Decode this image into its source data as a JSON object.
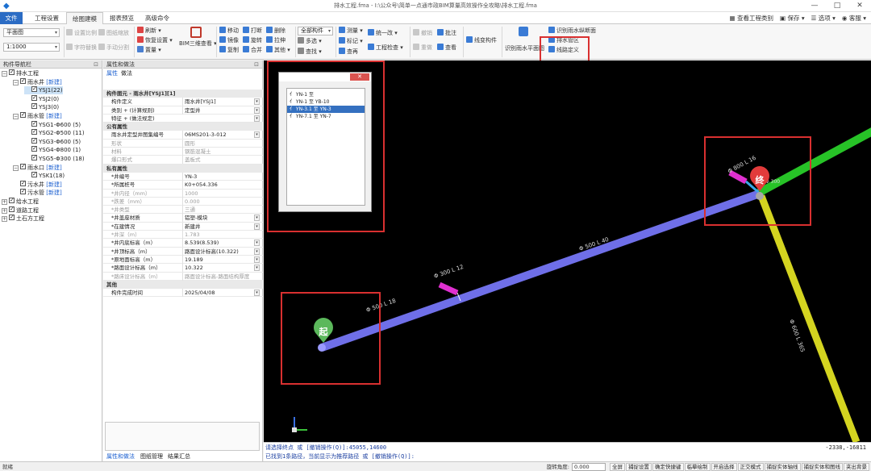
{
  "window": {
    "title": "排水工程.fma - I:\\公众号\\简单一点通市政BIM算量高效操作全攻略\\排水工程.fma",
    "controls": [
      "—",
      "□",
      "✕"
    ]
  },
  "menu": {
    "tabs": [
      "文件",
      "工程设置",
      "绘图建模",
      "报表预览",
      "高级命令"
    ],
    "active_tab": "绘图建模",
    "right": [
      "查看工程类别",
      "保存",
      "选项",
      "客服"
    ]
  },
  "ribbon": {
    "view_combo": "平面图",
    "scale_combo": "1:1000",
    "g1": [
      "设置比例",
      "图纸缩放",
      "字符替换",
      "手动分割"
    ],
    "g2": [
      "刷新",
      "恢复设置",
      "置量"
    ],
    "bim_label": "BIM三维查看",
    "g3": [
      "移动",
      "打断",
      "删除",
      "镜像",
      "旋转",
      "拉伸",
      "复制",
      "合并",
      "其他"
    ],
    "g4": [
      "全部构件",
      "多选",
      "查找"
    ],
    "g5": [
      "测量",
      "标记",
      "查再"
    ],
    "g6": [
      "统一改",
      "工程检查"
    ],
    "g7": [
      "撤销",
      "批注",
      "重做",
      "查看"
    ],
    "g8": [
      "线变构件"
    ],
    "g9": [
      "识别雨水平面图"
    ],
    "g10": [
      "识别雨水纵断面",
      "排水管区",
      "线路定义"
    ]
  },
  "nav": {
    "header": "构件导航栏",
    "pin": "⊡",
    "tree": [
      {
        "indent": 0,
        "toggle": "−",
        "checked": true,
        "label": "排水工程",
        "tag": ""
      },
      {
        "indent": 1,
        "toggle": "−",
        "checked": true,
        "label": "雨水井",
        "tag": "[新建]"
      },
      {
        "indent": 2,
        "toggle": "",
        "checked": true,
        "label": "YSJ1(22)",
        "tag": "",
        "selected": true
      },
      {
        "indent": 2,
        "toggle": "",
        "checked": true,
        "label": "YSJ2(0)",
        "tag": ""
      },
      {
        "indent": 2,
        "toggle": "",
        "checked": true,
        "label": "YSJ3(0)",
        "tag": ""
      },
      {
        "indent": 1,
        "toggle": "−",
        "checked": true,
        "label": "雨水管",
        "tag": "[新建]"
      },
      {
        "indent": 2,
        "toggle": "",
        "checked": true,
        "label": "YSG1-Φ600 (5)",
        "tag": ""
      },
      {
        "indent": 2,
        "toggle": "",
        "checked": true,
        "label": "YSG2-Φ500 (11)",
        "tag": ""
      },
      {
        "indent": 2,
        "toggle": "",
        "checked": true,
        "label": "YSG3-Φ600 (5)",
        "tag": ""
      },
      {
        "indent": 2,
        "toggle": "",
        "checked": true,
        "label": "YSG4-Φ800 (1)",
        "tag": ""
      },
      {
        "indent": 2,
        "toggle": "",
        "checked": true,
        "label": "YSG5-Φ300 (18)",
        "tag": ""
      },
      {
        "indent": 1,
        "toggle": "−",
        "checked": true,
        "label": "雨水口",
        "tag": "[新建]"
      },
      {
        "indent": 2,
        "toggle": "",
        "checked": true,
        "label": "YSK1(18)",
        "tag": ""
      },
      {
        "indent": 1,
        "toggle": "",
        "checked": true,
        "label": "污水井",
        "tag": "[新建]"
      },
      {
        "indent": 1,
        "toggle": "",
        "checked": true,
        "label": "污水管",
        "tag": "[新建]"
      },
      {
        "indent": 0,
        "toggle": "+",
        "checked": true,
        "label": "给水工程",
        "tag": ""
      },
      {
        "indent": 0,
        "toggle": "+",
        "checked": true,
        "label": "道路工程",
        "tag": ""
      },
      {
        "indent": 0,
        "toggle": "+",
        "checked": true,
        "label": "土石方工程",
        "tag": ""
      }
    ]
  },
  "props": {
    "header": "属性和做法",
    "tabs": [
      "属性",
      "做法"
    ],
    "rows": [
      {
        "t": "sec",
        "k": "构件图元 - 雨水井[YSJ1][1]",
        "v": ""
      },
      {
        "t": "row",
        "k": "构件定义",
        "v": "雨水井[YSJ1]",
        "dd": true
      },
      {
        "t": "row",
        "k": "类别 + (计算规则)",
        "v": "定型井",
        "dd": true
      },
      {
        "t": "row",
        "k": "特征 + (做法规定)",
        "v": "",
        "dd": true
      },
      {
        "t": "sec",
        "k": "公有属性",
        "v": ""
      },
      {
        "t": "row",
        "k": "雨水井定型井图集编号",
        "v": "06MS201-3-012",
        "dd": true
      },
      {
        "t": "gray",
        "k": "形状",
        "v": "圆形"
      },
      {
        "t": "gray",
        "k": "材料",
        "v": "钢筋混凝土"
      },
      {
        "t": "gray",
        "k": "爆口形式",
        "v": "盖板式"
      },
      {
        "t": "sec",
        "k": "私有属性",
        "v": ""
      },
      {
        "t": "row",
        "k": "*井编号",
        "v": "YN-3"
      },
      {
        "t": "row",
        "k": "*所属桩号",
        "v": "K0+054.336"
      },
      {
        "t": "gray",
        "k": "*井内径（mm）",
        "v": "1000"
      },
      {
        "t": "gray",
        "k": "*跌差（mm）",
        "v": "0.000"
      },
      {
        "t": "gray",
        "k": "*井类型",
        "v": "三通"
      },
      {
        "t": "row",
        "k": "*井盖座材质",
        "v": "铝塑-模块",
        "dd": true
      },
      {
        "t": "row",
        "k": "*在建情况",
        "v": "新建井",
        "dd": true
      },
      {
        "t": "gray",
        "k": "*井深（m）",
        "v": "1.783"
      },
      {
        "t": "row",
        "k": "*井内底标高（m）",
        "v": "8.539(8.539)",
        "dd": true
      },
      {
        "t": "row",
        "k": "*井顶标高（m）",
        "v": "路面设计标高(10.322)",
        "dd": true
      },
      {
        "t": "row",
        "k": "*原地面标高（m）",
        "v": "19.189",
        "dd": true
      },
      {
        "t": "row",
        "k": "*路面设计标高（m）",
        "v": "10.322",
        "dd": true
      },
      {
        "t": "gray",
        "k": "*路床设计标高（m）",
        "v": "路面设计标高-路面结构厚度"
      },
      {
        "t": "sec",
        "k": "其他",
        "v": ""
      },
      {
        "t": "row",
        "k": "构件完成时间",
        "v": "2025/04/08",
        "dd": true
      }
    ],
    "bottom_tabs": [
      "属性和做法",
      "图纸管理",
      "结果汇总"
    ]
  },
  "dialog": {
    "close": "✕",
    "routes": [
      "YN-1 至",
      "YN-1 至 YB-10",
      "YN-3.1 至 YN-3",
      "YN-7.1 至 YN-7"
    ],
    "selected_index": 2
  },
  "canvas": {
    "pipe_labels": [
      "Φ 500 L 18",
      "Φ 300 L 12",
      "Φ 500 L 40",
      "Φ 800 L 16",
      "Φ 600 L 365",
      "Φ 300"
    ],
    "start_marker": "起",
    "end_marker": "终"
  },
  "command": {
    "line1": "请选择终点 或 [撤销操作(Q)]:45055,14600",
    "line2": "已找到1条路径，当前显示为推荐路径 或 [撤销操作(Q)]:",
    "coord": "-2338,-16811"
  },
  "status": {
    "left": "就绪",
    "rotate_label": "旋转角度:",
    "rotate_value": "0.000",
    "toggles": [
      "全屏",
      "捕捉设置",
      "确定快捷键",
      "临摹绘制",
      "开启选择",
      "正交模式",
      "捕捉实体轴线",
      "捕捉实体和图线",
      "夹出背景"
    ]
  },
  "colors": {
    "accent": "#2b6cc4",
    "highlight": "#d93030",
    "pipe_main": "#6f6fe8",
    "pipe_green": "#27c327",
    "pipe_yellow": "#d4d420",
    "pipe_magenta": "#e030d0"
  }
}
